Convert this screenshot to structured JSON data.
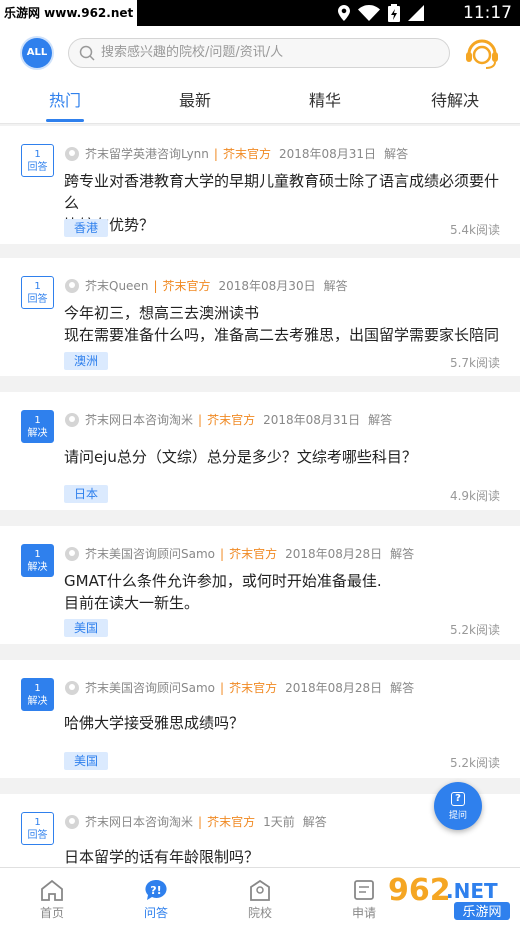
{
  "statusbar": {
    "site_label": "乐游网 www.962.net",
    "time": "11:17"
  },
  "header": {
    "all_label": "ALL",
    "search_placeholder": "搜索感兴趣的院校/问题/资讯/人"
  },
  "tabs": [
    {
      "label": "热门",
      "active": true
    },
    {
      "label": "最新",
      "active": false
    },
    {
      "label": "精华",
      "active": false
    },
    {
      "label": "待解决",
      "active": false
    }
  ],
  "questions": [
    {
      "count": "1",
      "status": "回答",
      "author": "芥末留学英港咨询Lynn",
      "official": "芥末官方",
      "date": "2018年08月31日",
      "action": "解答",
      "line1": "跨专业对香港教育大学的早期儿童教育硕士除了语言成绩必须要什么",
      "line2": "比较有优势？",
      "tag": "香港",
      "reads": "5.4k阅读"
    },
    {
      "count": "1",
      "status": "回答",
      "author": "芥末Queen",
      "official": "芥末官方",
      "date": "2018年08月30日",
      "action": "解答",
      "line1": "今年初三，想高三去澳洲读书",
      "line2": "现在需要准备什么吗，准备高二去考雅思，出国留学需要家长陪同",
      "tag": "澳洲",
      "reads": "5.7k阅读"
    },
    {
      "count": "1",
      "status": "解决",
      "author": "芥末网日本咨询淘米",
      "official": "芥末官方",
      "date": "2018年08月31日",
      "action": "解答",
      "line1": "请问eju总分（文综）总分是多少？文综考哪些科目？",
      "line2": "",
      "tag": "日本",
      "reads": "4.9k阅读"
    },
    {
      "count": "1",
      "status": "解决",
      "author": "芥末美国咨询顾问Samo",
      "official": "芥末官方",
      "date": "2018年08月28日",
      "action": "解答",
      "line1": "GMAT什么条件允许参加，或何时开始准备最佳.",
      "line2": "目前在读大一新生。",
      "tag": "美国",
      "reads": "5.2k阅读"
    },
    {
      "count": "1",
      "status": "解决",
      "author": "芥末美国咨询顾问Samo",
      "official": "芥末官方",
      "date": "2018年08月28日",
      "action": "解答",
      "line1": "哈佛大学接受雅思成绩吗？",
      "line2": "",
      "tag": "美国",
      "reads": "5.2k阅读"
    },
    {
      "count": "1",
      "status": "回答",
      "author": "芥末网日本咨询淘米",
      "official": "芥末官方",
      "date": "1天前",
      "action": "解答",
      "line1": "日本留学的话有年龄限制吗？",
      "line2": "",
      "tag": "",
      "reads": ""
    }
  ],
  "fab": {
    "label": "提问",
    "icon": "question-icon"
  },
  "bottomnav": [
    {
      "label": "首页",
      "icon": "home-icon",
      "active": false
    },
    {
      "label": "问答",
      "icon": "qa-icon",
      "active": true
    },
    {
      "label": "院校",
      "icon": "school-icon",
      "active": false
    },
    {
      "label": "申请",
      "icon": "apply-icon",
      "active": false
    }
  ],
  "watermark": {
    "text1": "962",
    "text2": ".NET",
    "text3": "乐游网"
  },
  "colors": {
    "accent": "#2f80ed",
    "official": "#f08a24",
    "tag_bg": "#dbeafe"
  }
}
